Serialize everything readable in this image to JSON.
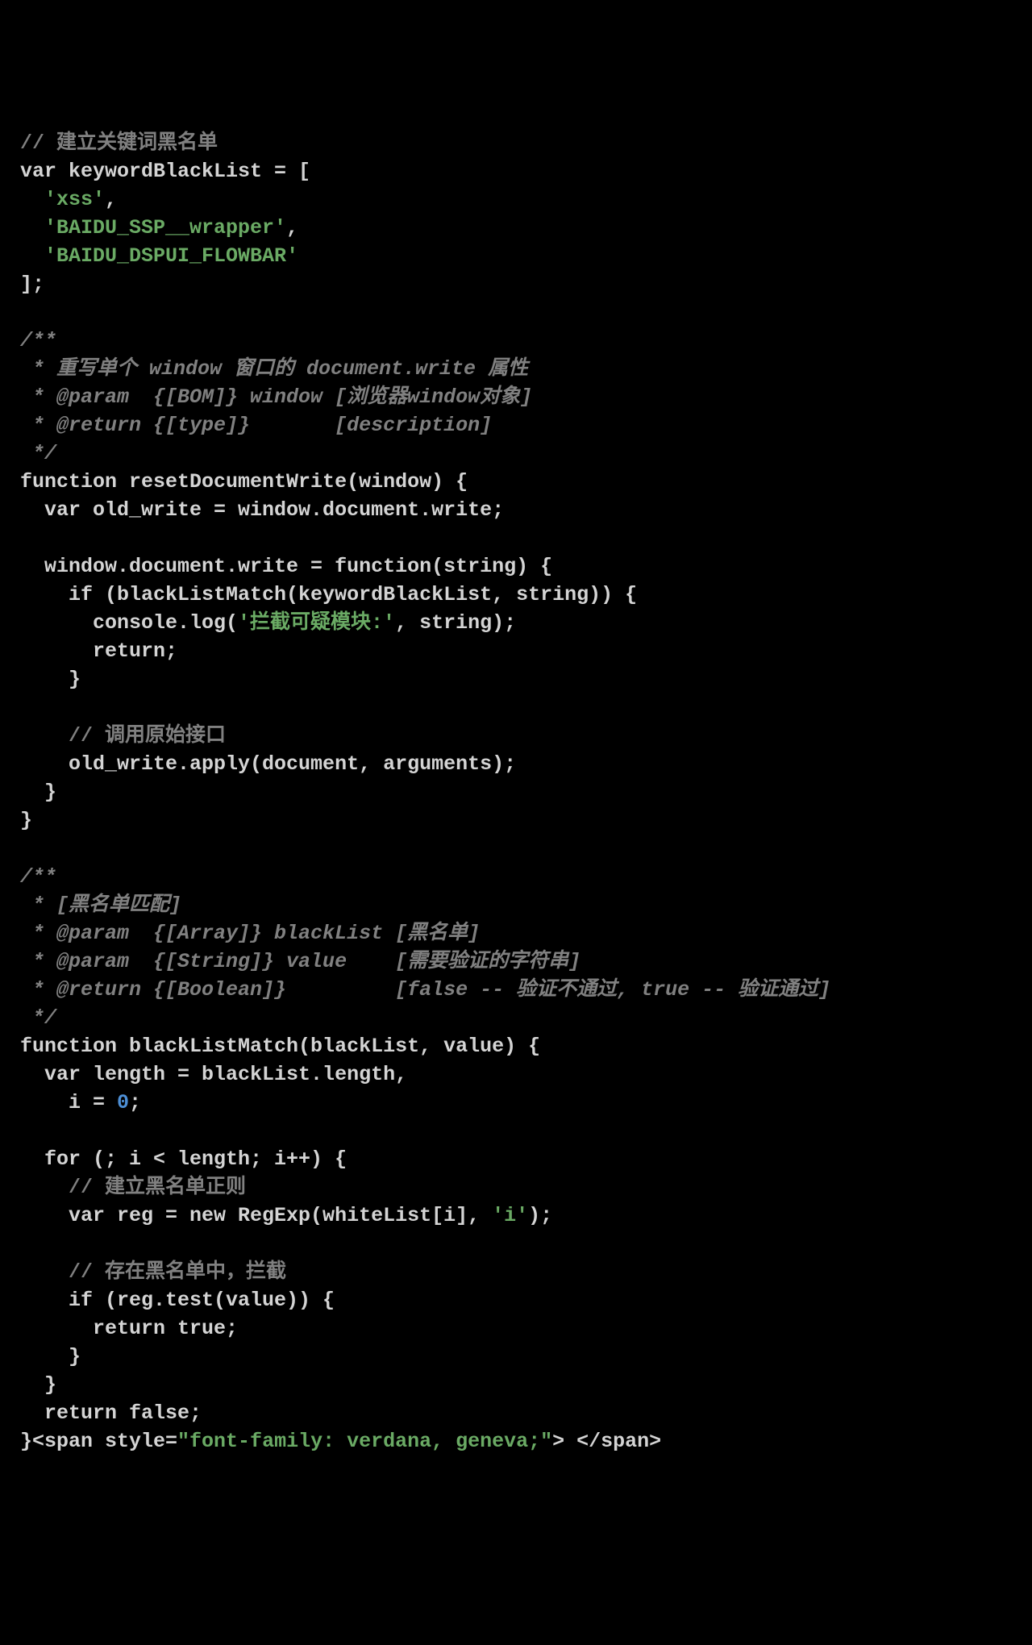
{
  "lines": {
    "l01_a": "// 建立关键词黑名单",
    "l02_a": "var keywordBlackList = [",
    "l03_a": "  ",
    "l03_b": "'xss'",
    "l03_c": ",",
    "l04_a": "  ",
    "l04_b": "'BAIDU_SSP__wrapper'",
    "l04_c": ",",
    "l05_a": "  ",
    "l05_b": "'BAIDU_DSPUI_FLOWBAR'",
    "l06_a": "];",
    "l08_a": "/**",
    "l09_a": " * 重写单个 window 窗口的 document.write 属性",
    "l10_a": " * @param  {[BOM]} window [浏览器window对象]",
    "l11_a": " * @return {[type]}       [description]",
    "l12_a": " */",
    "l13_a": "function resetDocumentWrite(window) {",
    "l14_a": "  var old_write = window.document.write;",
    "l16_a": "  window.document.write = function(string) {",
    "l17_a": "    if (blackListMatch(keywordBlackList, string)) {",
    "l18_a": "      console.log(",
    "l18_b": "'拦截可疑模块:'",
    "l18_c": ", string);",
    "l19_a": "      return;",
    "l20_a": "    }",
    "l22_a": "    // 调用原始接口",
    "l23_a": "    old_write.apply(document, arguments);",
    "l24_a": "  }",
    "l25_a": "}",
    "l27_a": "/**",
    "l28_a": " * [黑名单匹配]",
    "l29_a": " * @param  {[Array]} blackList [黑名单]",
    "l30_a": " * @param  {[String]} value    [需要验证的字符串]",
    "l31_a": " * @return {[Boolean]}         [false -- 验证不通过, true -- 验证通过]",
    "l32_a": " */",
    "l33_a": "function blackListMatch(blackList, value) {",
    "l34_a": "  var length = blackList.length,",
    "l35_a": "    i = ",
    "l35_b": "0",
    "l35_c": ";",
    "l37_a": "  for (; i < length; i++) {",
    "l38_a": "    // 建立黑名单正则",
    "l39_a": "    var reg = new RegExp(whiteList[i], ",
    "l39_b": "'i'",
    "l39_c": ");",
    "l41_a": "    // 存在黑名单中，拦截",
    "l42_a": "    if (reg.test(value)) {",
    "l43_a": "      return true;",
    "l44_a": "    }",
    "l45_a": "  }",
    "l46_a": "  return false;",
    "l47_a": "}<span style=",
    "l47_b": "\"font-family: verdana, geneva;\"",
    "l47_c": "> </span>"
  }
}
